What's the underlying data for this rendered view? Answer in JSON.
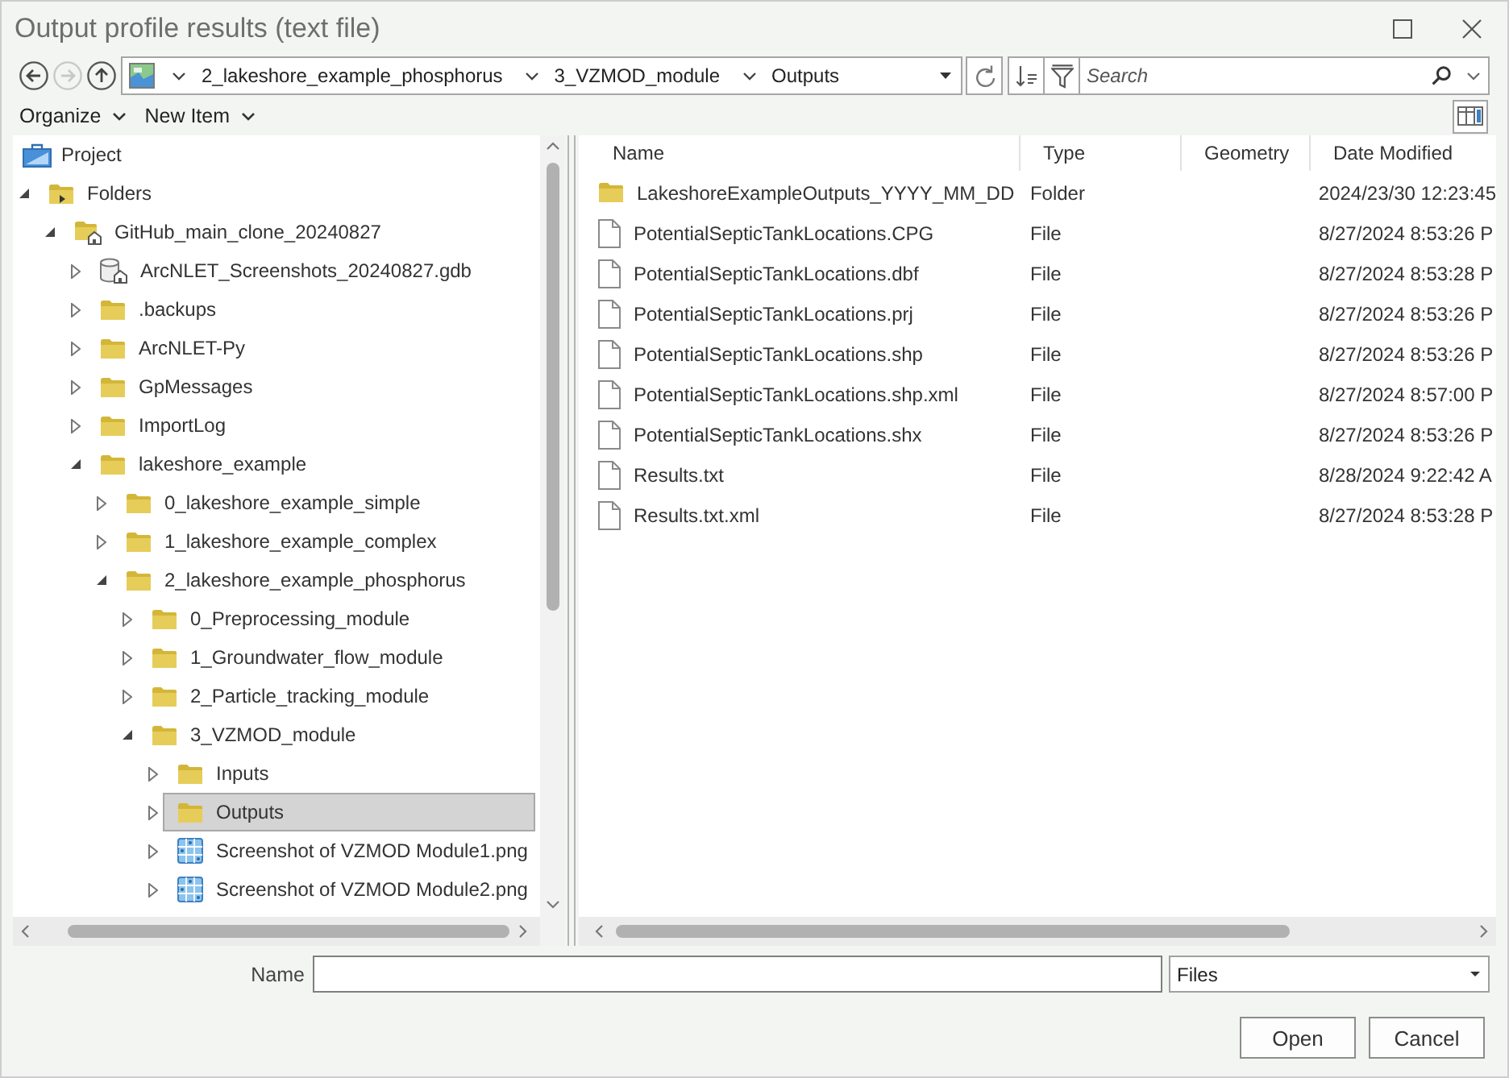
{
  "window": {
    "title": "Output profile results (text file)"
  },
  "nav_buttons": [
    {
      "kind": "back",
      "disabled": false
    },
    {
      "kind": "forward",
      "disabled": true
    },
    {
      "kind": "up",
      "disabled": false
    }
  ],
  "address_bar": {
    "crumbs": [
      "2_lakeshore_example_phosphorus",
      "3_VZMOD_module",
      "Outputs"
    ]
  },
  "search": {
    "placeholder": "Search"
  },
  "toolbar": {
    "menus": [
      "Organize",
      "New Item"
    ]
  },
  "tree": [
    {
      "label": "Project",
      "kind": "project",
      "selected": false
    },
    {
      "label": "Folders",
      "kind": "folder-connection",
      "selected": false,
      "expanded": true,
      "children": [
        {
          "label": "GitHub_main_clone_20240827",
          "kind": "home-folder",
          "selected": false,
          "expanded": true,
          "children": [
            {
              "label": "ArcNLET_Screenshots_20240827.gdb",
              "kind": "geodatabase",
              "selected": false,
              "expanded": false
            },
            {
              "label": ".backups",
              "kind": "folder",
              "selected": false,
              "expanded": false
            },
            {
              "label": "ArcNLET-Py",
              "kind": "folder",
              "selected": false,
              "expanded": false
            },
            {
              "label": "GpMessages",
              "kind": "folder",
              "selected": false,
              "expanded": false
            },
            {
              "label": "ImportLog",
              "kind": "folder",
              "selected": false,
              "expanded": false
            },
            {
              "label": "lakeshore_example",
              "kind": "folder",
              "selected": false,
              "expanded": true,
              "children": [
                {
                  "label": "0_lakeshore_example_simple",
                  "kind": "folder",
                  "selected": false,
                  "expanded": false
                },
                {
                  "label": "1_lakeshore_example_complex",
                  "kind": "folder",
                  "selected": false,
                  "expanded": false
                },
                {
                  "label": "2_lakeshore_example_phosphorus",
                  "kind": "folder",
                  "selected": false,
                  "expanded": true,
                  "children": [
                    {
                      "label": "0_Preprocessing_module",
                      "kind": "folder",
                      "selected": false,
                      "expanded": false
                    },
                    {
                      "label": "1_Groundwater_flow_module",
                      "kind": "folder",
                      "selected": false,
                      "expanded": false
                    },
                    {
                      "label": "2_Particle_tracking_module",
                      "kind": "folder",
                      "selected": false,
                      "expanded": false
                    },
                    {
                      "label": "3_VZMOD_module",
                      "kind": "folder",
                      "selected": false,
                      "expanded": true,
                      "children": [
                        {
                          "label": "Inputs",
                          "kind": "folder",
                          "selected": false,
                          "expanded": false
                        },
                        {
                          "label": "Outputs",
                          "kind": "folder",
                          "selected": true,
                          "expanded": false
                        },
                        {
                          "label": "Screenshot of VZMOD Module1.png",
                          "kind": "image",
                          "selected": false,
                          "expanded": false
                        },
                        {
                          "label": "Screenshot of VZMOD Module2.png",
                          "kind": "image",
                          "selected": false,
                          "expanded": false
                        }
                      ]
                    }
                  ]
                }
              ]
            }
          ]
        }
      ]
    }
  ],
  "table": {
    "columns": [
      "Name",
      "Type",
      "Geometry",
      "Date Modified"
    ],
    "rows": [
      {
        "kind": "folder",
        "name": "LakeshoreExampleOutputs_YYYY_MM_DD",
        "type": "Folder",
        "date_modified": "2024/23/30 12:23:45"
      },
      {
        "kind": "file",
        "name": "PotentialSepticTankLocations.CPG",
        "type": "File",
        "date_modified": "8/27/2024 8:53:26 P"
      },
      {
        "kind": "file",
        "name": "PotentialSepticTankLocations.dbf",
        "type": "File",
        "date_modified": "8/27/2024 8:53:28 P"
      },
      {
        "kind": "file",
        "name": "PotentialSepticTankLocations.prj",
        "type": "File",
        "date_modified": "8/27/2024 8:53:26 P"
      },
      {
        "kind": "file",
        "name": "PotentialSepticTankLocations.shp",
        "type": "File",
        "date_modified": "8/27/2024 8:53:26 P"
      },
      {
        "kind": "file",
        "name": "PotentialSepticTankLocations.shp.xml",
        "type": "File",
        "date_modified": "8/27/2024 8:57:00 P"
      },
      {
        "kind": "file",
        "name": "PotentialSepticTankLocations.shx",
        "type": "File",
        "date_modified": "8/27/2024 8:53:26 P"
      },
      {
        "kind": "file",
        "name": "Results.txt",
        "type": "File",
        "date_modified": "8/28/2024 9:22:42 A"
      },
      {
        "kind": "file",
        "name": "Results.txt.xml",
        "type": "File",
        "date_modified": "8/27/2024 8:53:28 P"
      }
    ]
  },
  "name_field": {
    "label": "Name"
  },
  "file_type": {
    "value": "Files"
  },
  "buttons": [
    "Open",
    "Cancel"
  ]
}
